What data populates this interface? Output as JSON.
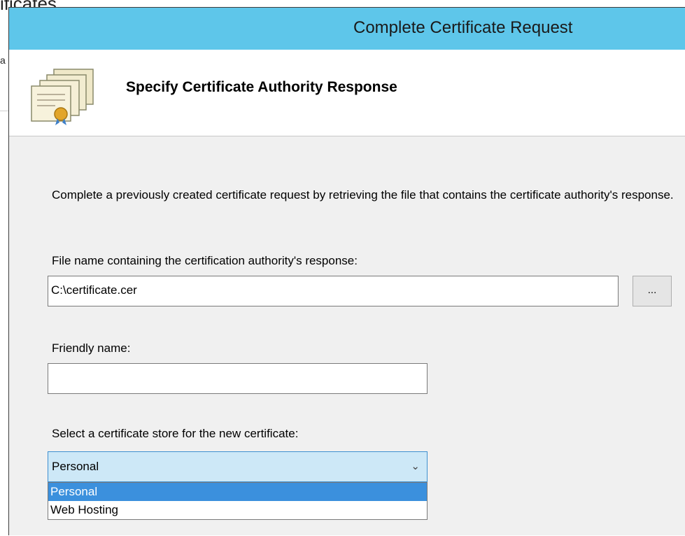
{
  "background": {
    "title_fragment": "ificates",
    "side_fragment": "a"
  },
  "dialog": {
    "title": "Complete Certificate Request",
    "header_title": "Specify Certificate Authority Response",
    "description": "Complete a previously created certificate request by retrieving the file that contains the certificate authority's response.",
    "file_label": "File name containing the certification authority's response:",
    "file_value": "C:\\certificate.cer",
    "browse_label": "...",
    "friendly_label": "Friendly name:",
    "friendly_value": "",
    "store_label": "Select a certificate store for the new certificate:",
    "store_selected": "Personal",
    "store_options": [
      "Personal",
      "Web Hosting"
    ]
  },
  "colors": {
    "titlebar": "#5ec6ea",
    "selection": "#3b90dd"
  }
}
